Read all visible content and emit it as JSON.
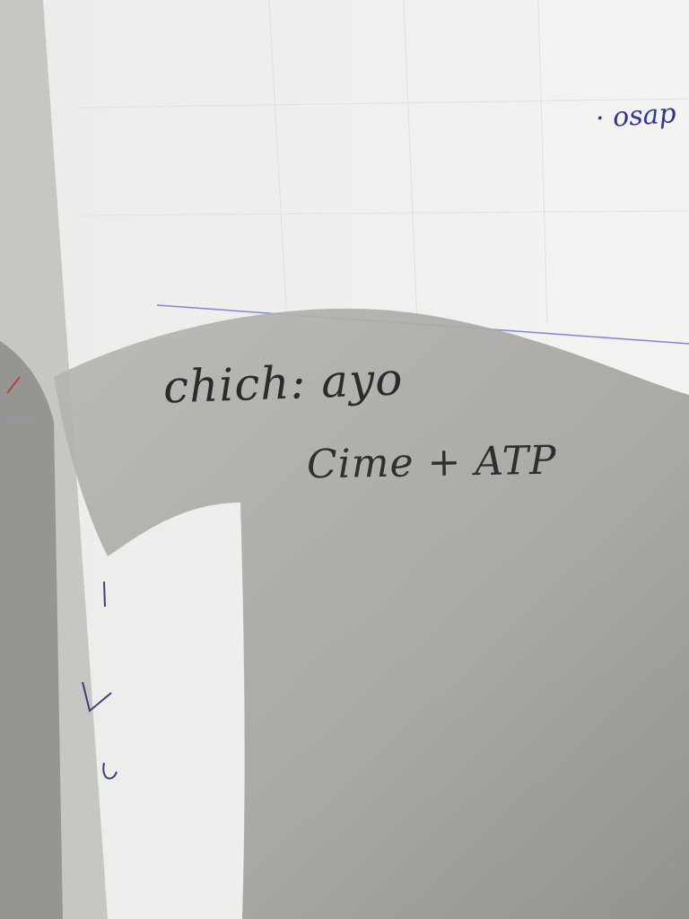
{
  "notes": {
    "line_1": "chich: ayo",
    "line_2": "Cime + ATP",
    "corner_word": "· osap"
  },
  "colors": {
    "ink_pencil": "#2b2b2b",
    "ink_blue": "#2d3a8c",
    "rule_line": "#7f86d8",
    "paper": "#f1f1ef",
    "shadow": "#9a9995"
  }
}
